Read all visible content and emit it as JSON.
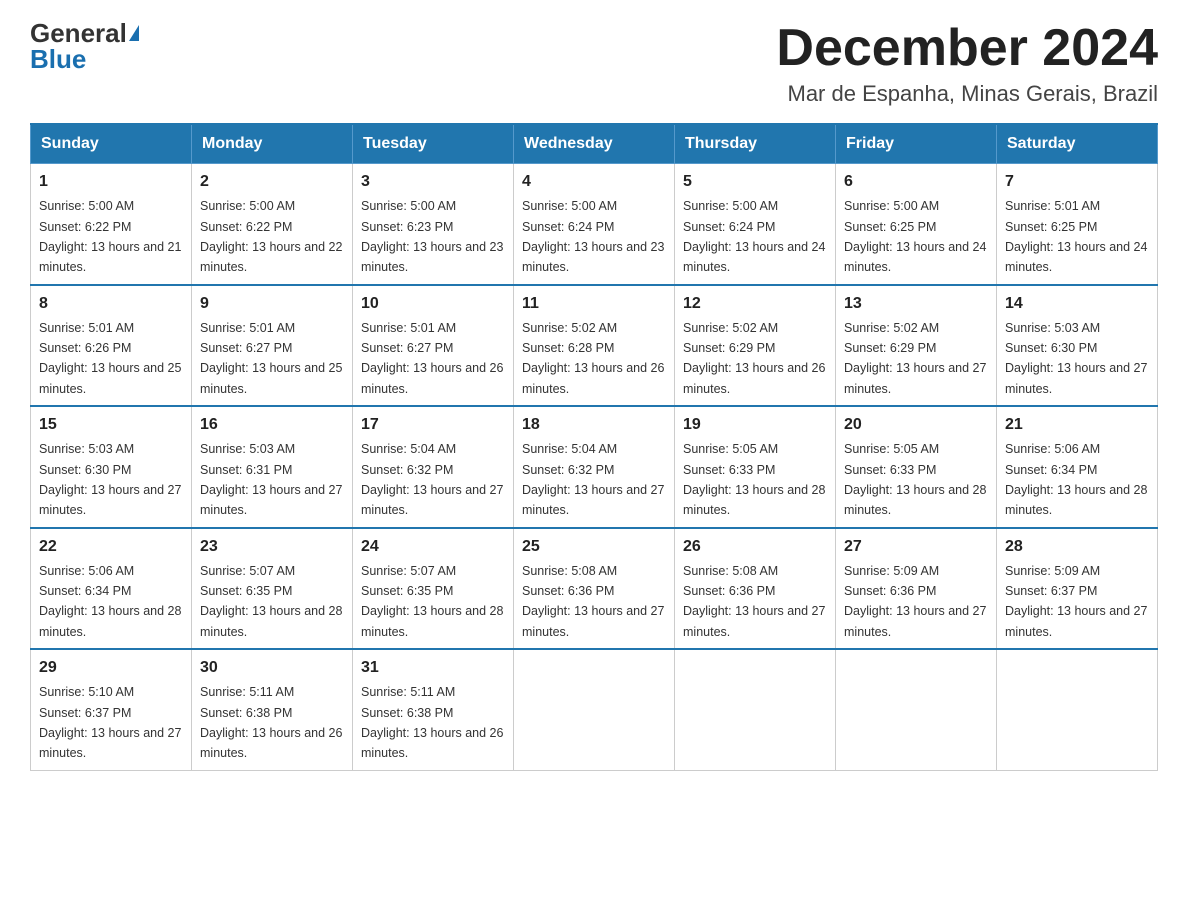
{
  "logo": {
    "general": "General",
    "blue": "Blue"
  },
  "title": "December 2024",
  "subtitle": "Mar de Espanha, Minas Gerais, Brazil",
  "days_of_week": [
    "Sunday",
    "Monday",
    "Tuesday",
    "Wednesday",
    "Thursday",
    "Friday",
    "Saturday"
  ],
  "weeks": [
    [
      {
        "day": "1",
        "sunrise": "5:00 AM",
        "sunset": "6:22 PM",
        "daylight": "13 hours and 21 minutes."
      },
      {
        "day": "2",
        "sunrise": "5:00 AM",
        "sunset": "6:22 PM",
        "daylight": "13 hours and 22 minutes."
      },
      {
        "day": "3",
        "sunrise": "5:00 AM",
        "sunset": "6:23 PM",
        "daylight": "13 hours and 23 minutes."
      },
      {
        "day": "4",
        "sunrise": "5:00 AM",
        "sunset": "6:24 PM",
        "daylight": "13 hours and 23 minutes."
      },
      {
        "day": "5",
        "sunrise": "5:00 AM",
        "sunset": "6:24 PM",
        "daylight": "13 hours and 24 minutes."
      },
      {
        "day": "6",
        "sunrise": "5:00 AM",
        "sunset": "6:25 PM",
        "daylight": "13 hours and 24 minutes."
      },
      {
        "day": "7",
        "sunrise": "5:01 AM",
        "sunset": "6:25 PM",
        "daylight": "13 hours and 24 minutes."
      }
    ],
    [
      {
        "day": "8",
        "sunrise": "5:01 AM",
        "sunset": "6:26 PM",
        "daylight": "13 hours and 25 minutes."
      },
      {
        "day": "9",
        "sunrise": "5:01 AM",
        "sunset": "6:27 PM",
        "daylight": "13 hours and 25 minutes."
      },
      {
        "day": "10",
        "sunrise": "5:01 AM",
        "sunset": "6:27 PM",
        "daylight": "13 hours and 26 minutes."
      },
      {
        "day": "11",
        "sunrise": "5:02 AM",
        "sunset": "6:28 PM",
        "daylight": "13 hours and 26 minutes."
      },
      {
        "day": "12",
        "sunrise": "5:02 AM",
        "sunset": "6:29 PM",
        "daylight": "13 hours and 26 minutes."
      },
      {
        "day": "13",
        "sunrise": "5:02 AM",
        "sunset": "6:29 PM",
        "daylight": "13 hours and 27 minutes."
      },
      {
        "day": "14",
        "sunrise": "5:03 AM",
        "sunset": "6:30 PM",
        "daylight": "13 hours and 27 minutes."
      }
    ],
    [
      {
        "day": "15",
        "sunrise": "5:03 AM",
        "sunset": "6:30 PM",
        "daylight": "13 hours and 27 minutes."
      },
      {
        "day": "16",
        "sunrise": "5:03 AM",
        "sunset": "6:31 PM",
        "daylight": "13 hours and 27 minutes."
      },
      {
        "day": "17",
        "sunrise": "5:04 AM",
        "sunset": "6:32 PM",
        "daylight": "13 hours and 27 minutes."
      },
      {
        "day": "18",
        "sunrise": "5:04 AM",
        "sunset": "6:32 PM",
        "daylight": "13 hours and 27 minutes."
      },
      {
        "day": "19",
        "sunrise": "5:05 AM",
        "sunset": "6:33 PM",
        "daylight": "13 hours and 28 minutes."
      },
      {
        "day": "20",
        "sunrise": "5:05 AM",
        "sunset": "6:33 PM",
        "daylight": "13 hours and 28 minutes."
      },
      {
        "day": "21",
        "sunrise": "5:06 AM",
        "sunset": "6:34 PM",
        "daylight": "13 hours and 28 minutes."
      }
    ],
    [
      {
        "day": "22",
        "sunrise": "5:06 AM",
        "sunset": "6:34 PM",
        "daylight": "13 hours and 28 minutes."
      },
      {
        "day": "23",
        "sunrise": "5:07 AM",
        "sunset": "6:35 PM",
        "daylight": "13 hours and 28 minutes."
      },
      {
        "day": "24",
        "sunrise": "5:07 AM",
        "sunset": "6:35 PM",
        "daylight": "13 hours and 28 minutes."
      },
      {
        "day": "25",
        "sunrise": "5:08 AM",
        "sunset": "6:36 PM",
        "daylight": "13 hours and 27 minutes."
      },
      {
        "day": "26",
        "sunrise": "5:08 AM",
        "sunset": "6:36 PM",
        "daylight": "13 hours and 27 minutes."
      },
      {
        "day": "27",
        "sunrise": "5:09 AM",
        "sunset": "6:36 PM",
        "daylight": "13 hours and 27 minutes."
      },
      {
        "day": "28",
        "sunrise": "5:09 AM",
        "sunset": "6:37 PM",
        "daylight": "13 hours and 27 minutes."
      }
    ],
    [
      {
        "day": "29",
        "sunrise": "5:10 AM",
        "sunset": "6:37 PM",
        "daylight": "13 hours and 27 minutes."
      },
      {
        "day": "30",
        "sunrise": "5:11 AM",
        "sunset": "6:38 PM",
        "daylight": "13 hours and 26 minutes."
      },
      {
        "day": "31",
        "sunrise": "5:11 AM",
        "sunset": "6:38 PM",
        "daylight": "13 hours and 26 minutes."
      },
      null,
      null,
      null,
      null
    ]
  ]
}
